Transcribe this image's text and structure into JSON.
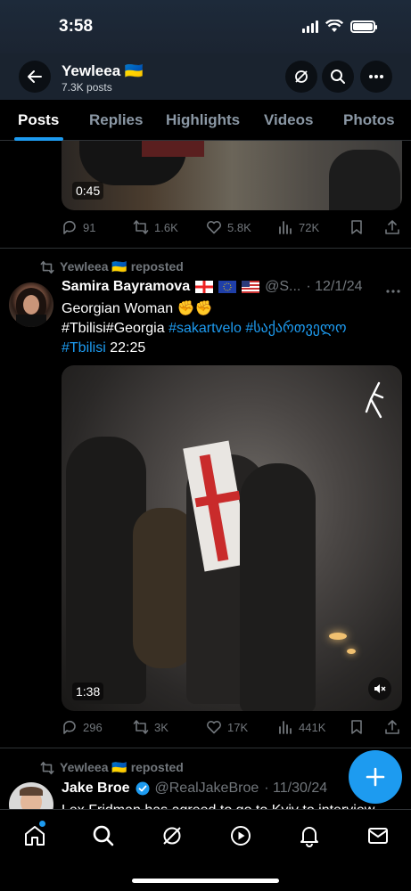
{
  "status_bar": {
    "time": "3:58"
  },
  "profile": {
    "name": "Yewleea",
    "flag": "🇺🇦",
    "post_count": "7.3K posts"
  },
  "tabs": [
    {
      "label": "Posts",
      "active": true
    },
    {
      "label": "Replies"
    },
    {
      "label": "Highlights"
    },
    {
      "label": "Videos"
    },
    {
      "label": "Photos"
    }
  ],
  "post1": {
    "duration": "0:45",
    "replies": "91",
    "reposts": "1.6K",
    "likes": "5.8K",
    "views": "72K"
  },
  "post2": {
    "repost_label": "Yewleea 🇺🇦 reposted",
    "author_name": "Samira Bayramova",
    "author_handle": "@S...",
    "date": "· 12/1/24",
    "text_plain1": "Georgian Woman ✊✊",
    "text_line2_plain": "#Tbilisi#Georgia",
    "text_line2_tags": "#sakartvelo #საქართველო",
    "text_line3_tag": "#Tbilisi",
    "text_line3_plain": "22:25",
    "duration": "1:38",
    "replies": "296",
    "reposts": "3K",
    "likes": "17K",
    "views": "441K"
  },
  "post3": {
    "repost_label": "Yewleea 🇺🇦 reposted",
    "author_name": "Jake Broe",
    "author_handle": "@RealJakeBroe",
    "date": "· 11/30/24",
    "text": "Lex Fridman has agreed to go to Kyiv to interview"
  },
  "colors": {
    "accent": "#1d9bf0",
    "muted": "#71767b",
    "background": "#000000"
  },
  "icons": [
    "back-arrow-icon",
    "grok-icon",
    "search-icon",
    "more-icon",
    "reply-icon",
    "repost-icon",
    "like-icon",
    "views-icon",
    "bookmark-icon",
    "share-icon",
    "mute-icon",
    "home-icon",
    "explore-icon",
    "grok-nav-icon",
    "video-icon",
    "notifications-icon",
    "messages-icon",
    "compose-icon"
  ]
}
